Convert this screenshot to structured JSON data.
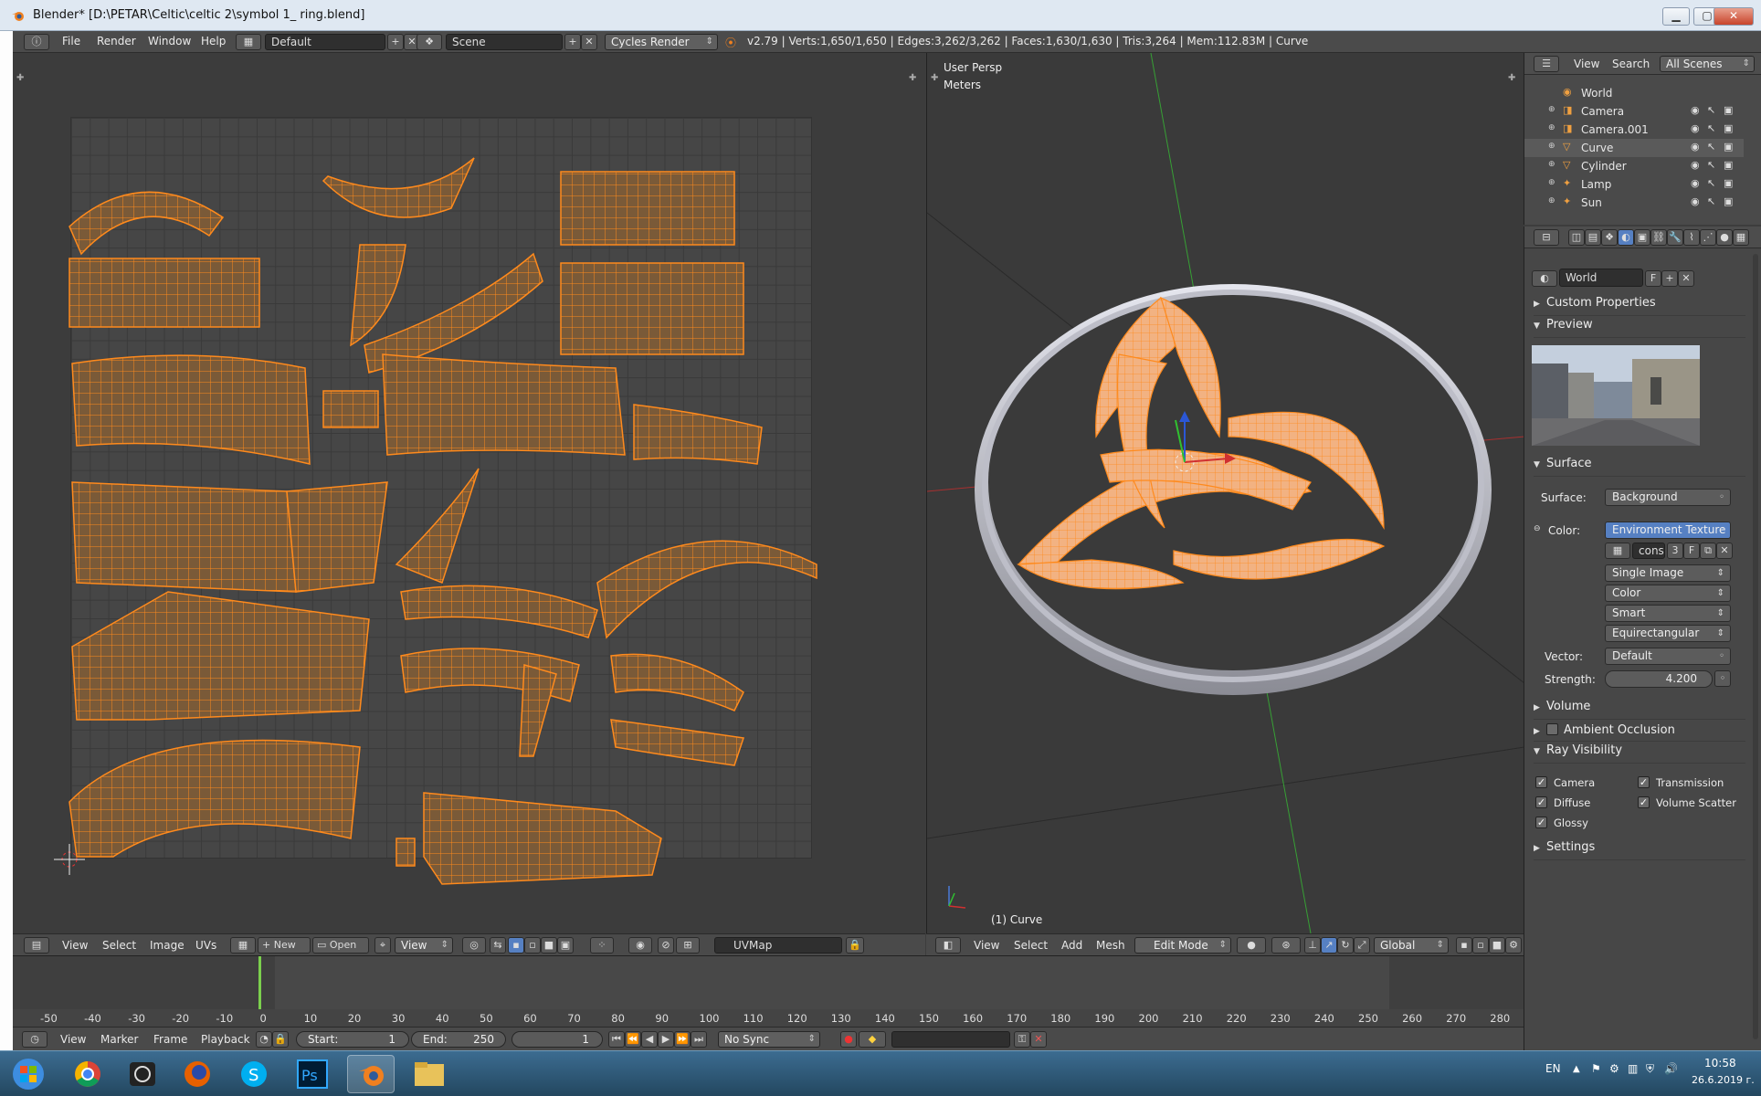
{
  "window": {
    "title": "Blender* [D:\\PETAR\\Celtic\\celtic 2\\symbol 1_ ring.blend]"
  },
  "menu": {
    "file": "File",
    "render": "Render",
    "window": "Window",
    "help": "Help"
  },
  "layout": {
    "screen": "Default",
    "scene": "Scene",
    "engine": "Cycles Render"
  },
  "stats": "v2.79 | Verts:1,650/1,650 | Edges:3,262/3,262 | Faces:1,630/1,630 | Tris:3,264 | Mem:112.83M | Curve",
  "viewport": {
    "view_label": "User Persp",
    "units_label": "Meters",
    "object_label": "(1) Curve",
    "header": {
      "view": "View",
      "select": "Select",
      "add": "Add",
      "mesh": "Mesh",
      "mode": "Edit Mode",
      "orientation": "Global"
    }
  },
  "uv_editor": {
    "header": {
      "view": "View",
      "select": "Select",
      "image": "Image",
      "uvs": "UVs",
      "new": "New",
      "open": "Open",
      "view2": "View",
      "uvmap": "UVMap"
    }
  },
  "outliner": {
    "header": {
      "view": "View",
      "search": "Search",
      "scope": "All Scenes"
    },
    "items": [
      {
        "label": "World",
        "icon": "world-icon"
      },
      {
        "label": "Camera",
        "icon": "camera-icon"
      },
      {
        "label": "Camera.001",
        "icon": "camera-icon"
      },
      {
        "label": "Curve",
        "icon": "curve-icon",
        "selected": true
      },
      {
        "label": "Cylinder",
        "icon": "mesh-icon"
      },
      {
        "label": "Lamp",
        "icon": "lamp-icon"
      },
      {
        "label": "Sun",
        "icon": "lamp-icon"
      }
    ]
  },
  "properties": {
    "world_name": "World",
    "world_flag": "F",
    "custom_properties": "Custom Properties",
    "preview": "Preview",
    "surface_section": "Surface",
    "surface_label": "Surface:",
    "surface_value": "Background",
    "color_label": "Color:",
    "color_value": "Environment Texture",
    "image_name": "cons",
    "image_users": "3",
    "image_flag": "F",
    "source": "Single Image",
    "color_space": "Color",
    "interpolation": "Smart",
    "projection": "Equirectangular",
    "vector_label": "Vector:",
    "vector_value": "Default",
    "strength_label": "Strength:",
    "strength_value": "4.200",
    "volume": "Volume",
    "ambient_occlusion": "Ambient Occlusion",
    "ray_visibility": "Ray Visibility",
    "rv_camera": "Camera",
    "rv_transmission": "Transmission",
    "rv_diffuse": "Diffuse",
    "rv_volume_scatter": "Volume Scatter",
    "rv_glossy": "Glossy",
    "settings": "Settings"
  },
  "timeline": {
    "ticks": [
      "-50",
      "-40",
      "-30",
      "-20",
      "-10",
      "0",
      "10",
      "20",
      "30",
      "40",
      "50",
      "60",
      "70",
      "80",
      "90",
      "100",
      "110",
      "120",
      "130",
      "140",
      "150",
      "160",
      "170",
      "180",
      "190",
      "200",
      "210",
      "220",
      "230",
      "240",
      "250",
      "260",
      "270",
      "280"
    ],
    "current_frame": 1,
    "header": {
      "view": "View",
      "marker": "Marker",
      "frame": "Frame",
      "playback": "Playback",
      "start_label": "Start:",
      "start": "1",
      "end_label": "End:",
      "end": "250",
      "current": "1",
      "sync": "No Sync"
    }
  },
  "taskbar": {
    "lang": "EN",
    "time": "10:58",
    "date": "26.6.2019 г."
  },
  "colors": {
    "accent": "#5680c2",
    "uv_orange": "#ff8a1c",
    "mesh_fill": "#7a5a38",
    "frame_marker": "#7bd04d"
  }
}
